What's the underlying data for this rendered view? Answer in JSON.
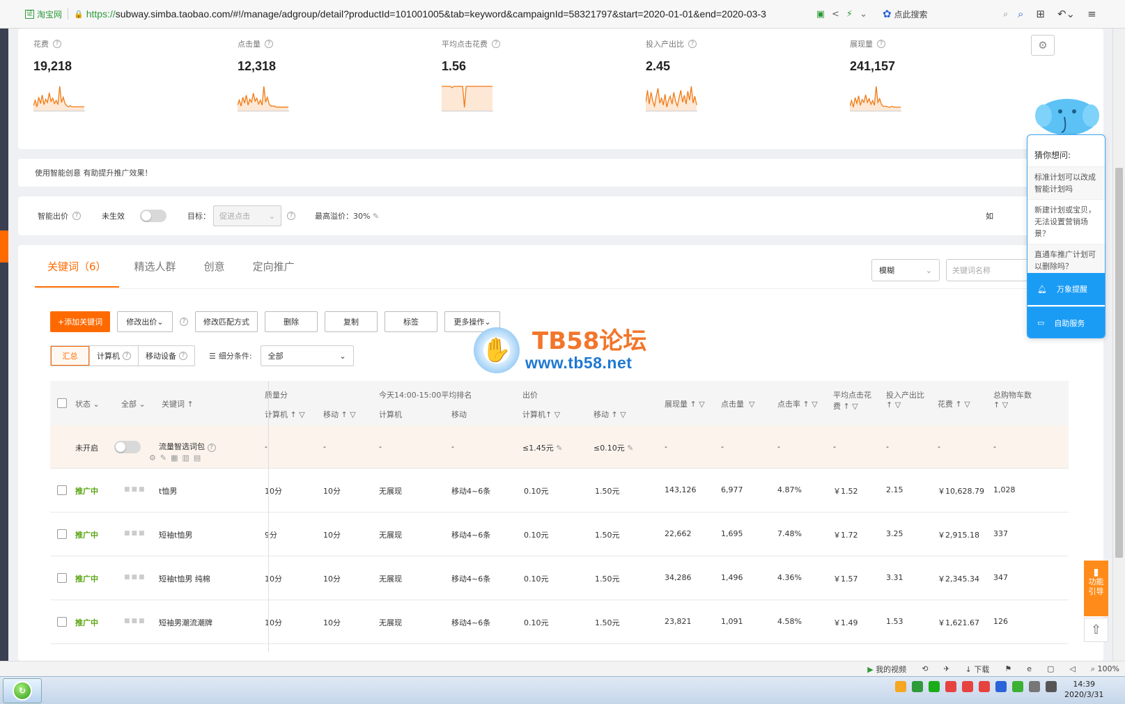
{
  "browser": {
    "cert_label": "淘宝网",
    "cert_icon": "证",
    "url_scheme": "https://",
    "url_rest": "subway.simba.taobao.com/#!/manage/adgroup/detail?productId=101001005&tab=keyword&campaignId=58321797&start=2020-01-01&end=2020-03-3",
    "search_label": "点此搜索"
  },
  "metrics": [
    {
      "label": "花费",
      "value": "19,218",
      "spark": [
        4,
        9,
        3,
        12,
        6,
        14,
        5,
        10,
        7,
        16,
        8,
        11,
        6,
        9,
        5,
        22,
        7,
        12,
        6,
        4,
        3,
        4,
        3,
        3,
        3,
        3,
        3,
        3,
        3,
        3
      ]
    },
    {
      "label": "点击量",
      "value": "12,318",
      "spark": [
        5,
        10,
        4,
        13,
        7,
        15,
        5,
        11,
        8,
        17,
        9,
        12,
        6,
        10,
        5,
        24,
        8,
        13,
        6,
        4,
        4,
        4,
        3,
        3,
        3,
        3,
        3,
        3,
        3,
        3
      ]
    },
    {
      "label": "平均点击花费",
      "value": "1.56",
      "spark": [
        18,
        18,
        18,
        18,
        18,
        18,
        17,
        18,
        18,
        18,
        18,
        18,
        18,
        2,
        18,
        18,
        18,
        18,
        18,
        18,
        18,
        18,
        18,
        18,
        18,
        18,
        18,
        18,
        18,
        18
      ]
    },
    {
      "label": "投入产出比",
      "value": "2.45",
      "spark": [
        8,
        20,
        6,
        18,
        9,
        4,
        14,
        22,
        7,
        12,
        5,
        16,
        3,
        10,
        14,
        6,
        18,
        9,
        4,
        12,
        20,
        8,
        15,
        6,
        19,
        10,
        24,
        7,
        14,
        5
      ]
    },
    {
      "label": "展现量",
      "value": "241,157",
      "spark": [
        4,
        10,
        3,
        13,
        7,
        15,
        5,
        11,
        8,
        16,
        8,
        12,
        6,
        10,
        5,
        25,
        8,
        12,
        6,
        4,
        4,
        4,
        3,
        3,
        4,
        3,
        3,
        3,
        3,
        3
      ]
    }
  ],
  "tip_text": "使用智能创意  有助提升推广效果！",
  "bid_bar": {
    "label": "智能出价",
    "status": "未生效",
    "goal_label": "目标：",
    "goal_value": "促进点击",
    "premium": "最高溢价：30%",
    "cut_text": "如"
  },
  "tabs": [
    "关键词（6）",
    "精选人群",
    "创意",
    "定向推广"
  ],
  "search": {
    "mode": "模糊",
    "placeholder": "关键词名称"
  },
  "buttons": {
    "add": "+添加关键词",
    "modify_bid": "修改出价",
    "modify_match": "修改匹配方式",
    "delete": "删除",
    "copy": "复制",
    "tag": "标签",
    "more": "更多操作"
  },
  "filters": {
    "summary": "汇总",
    "pc": "计算机",
    "mobile": "移动设备",
    "cond_label": "细分条件:",
    "cond_value": "全部"
  },
  "table": {
    "h_status": "状态",
    "h_all": "全部",
    "h_keyword": "关键词",
    "h_quality": "质量分",
    "h_rank": "今天14:00-15:00平均排名",
    "h_bid": "出价",
    "h_pc": "计算机",
    "h_mobile": "移动",
    "h_impr": "展现量",
    "h_clicks": "点击量",
    "h_ctr": "点击率",
    "h_cpc1": "平均点击花",
    "h_cpc2": "费",
    "h_roi": "投入产出比",
    "h_cost": "花费",
    "h_cart": "总购物车数",
    "special": {
      "status": "未开启",
      "name": "流量智选词包",
      "q_pc": "-",
      "q_mob": "-",
      "r_pc": "-",
      "r_mob": "-",
      "bid_pc": "≤1.45元",
      "bid_mob": "≤0.10元",
      "impr": "-",
      "clicks": "-",
      "ctr": "-",
      "cpc": "-",
      "roi": "-",
      "cost": "-",
      "cart": "-"
    },
    "rows": [
      {
        "status": "推广中",
        "keyword": "t恤男",
        "q_pc": "10分",
        "q_mob": "10分",
        "r_pc": "无展现",
        "r_mob": "移动4~6条",
        "bid_pc": "0.10元",
        "bid_mob": "1.50元",
        "impr": "143,126",
        "clicks": "6,977",
        "ctr": "4.87%",
        "cpc": "￥1.52",
        "roi": "2.15",
        "cost": "￥10,628.79",
        "cart": "1,028"
      },
      {
        "status": "推广中",
        "keyword": "短袖t恤男",
        "q_pc": "9分",
        "q_mob": "10分",
        "r_pc": "无展现",
        "r_mob": "移动4~6条",
        "bid_pc": "0.10元",
        "bid_mob": "1.50元",
        "impr": "22,662",
        "clicks": "1,695",
        "ctr": "7.48%",
        "cpc": "￥1.72",
        "roi": "3.25",
        "cost": "￥2,915.18",
        "cart": "337"
      },
      {
        "status": "推广中",
        "keyword": "短袖t恤男 纯棉",
        "q_pc": "10分",
        "q_mob": "10分",
        "r_pc": "无展现",
        "r_mob": "移动4~6条",
        "bid_pc": "0.10元",
        "bid_mob": "1.50元",
        "impr": "34,286",
        "clicks": "1,496",
        "ctr": "4.36%",
        "cpc": "￥1.57",
        "roi": "3.31",
        "cost": "￥2,345.34",
        "cart": "347"
      },
      {
        "status": "推广中",
        "keyword": "短袖男潮流潮牌",
        "q_pc": "10分",
        "q_mob": "10分",
        "r_pc": "无展现",
        "r_mob": "移动4~6条",
        "bid_pc": "0.10元",
        "bid_mob": "1.50元",
        "impr": "23,821",
        "clicks": "1,091",
        "ctr": "4.58%",
        "cpc": "￥1.49",
        "roi": "1.53",
        "cost": "￥1,621.67",
        "cart": "126"
      }
    ]
  },
  "assistant": {
    "title": "猜你想问:",
    "q1": "标准计划可以改成智能计划吗",
    "q2": "新建计划或宝贝，无法设置营销场景？",
    "q3": "直通车推广计划可以删除吗？",
    "btn1": "万象提醒",
    "btn2": "自助服务"
  },
  "guide": {
    "line1": "功能",
    "line2": "引导"
  },
  "watermark": {
    "title": "TB58论坛",
    "url": "www.tb58.net"
  },
  "statusbar": {
    "video": "我的视频",
    "download": "下载",
    "zoom": "100%"
  },
  "clock": {
    "time": "14:39",
    "date": "2020/3/31"
  },
  "colors": {
    "accent": "#ff6a00",
    "active_green": "#5aa412",
    "assistant_blue": "#1a9cf5"
  }
}
